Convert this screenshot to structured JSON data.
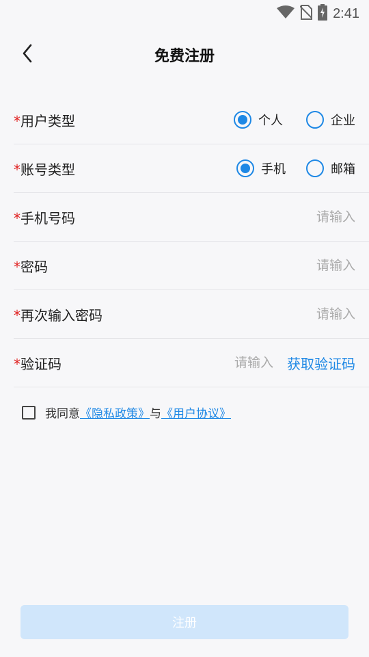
{
  "status_bar": {
    "time": "2:41"
  },
  "header": {
    "title": "免费注册"
  },
  "form": {
    "required_mark": "*",
    "user_type": {
      "label": "用户类型",
      "options": [
        {
          "label": "个人",
          "selected": true
        },
        {
          "label": "企业",
          "selected": false
        }
      ]
    },
    "account_type": {
      "label": "账号类型",
      "options": [
        {
          "label": "手机",
          "selected": true
        },
        {
          "label": "邮箱",
          "selected": false
        }
      ]
    },
    "phone": {
      "label": "手机号码",
      "placeholder": "请输入"
    },
    "password": {
      "label": "密码",
      "placeholder": "请输入"
    },
    "password_confirm": {
      "label": "再次输入密码",
      "placeholder": "请输入"
    },
    "verify_code": {
      "label": "验证码",
      "placeholder": "请输入",
      "get_code_label": "获取验证码"
    }
  },
  "agreement": {
    "prefix": "我同意",
    "privacy_link": "《隐私政策》",
    "joiner": "与",
    "terms_link": "《用户协议》",
    "checked": false
  },
  "register_button": {
    "label": "注册"
  },
  "colors": {
    "accent": "#1e88e5",
    "required": "#e01e1e",
    "button_disabled_bg": "#d0e6fb"
  },
  "icons": {
    "wifi": "wifi-icon",
    "no_sim": "no-sim-icon",
    "battery": "battery-charging-icon",
    "back": "back-arrow-icon"
  }
}
